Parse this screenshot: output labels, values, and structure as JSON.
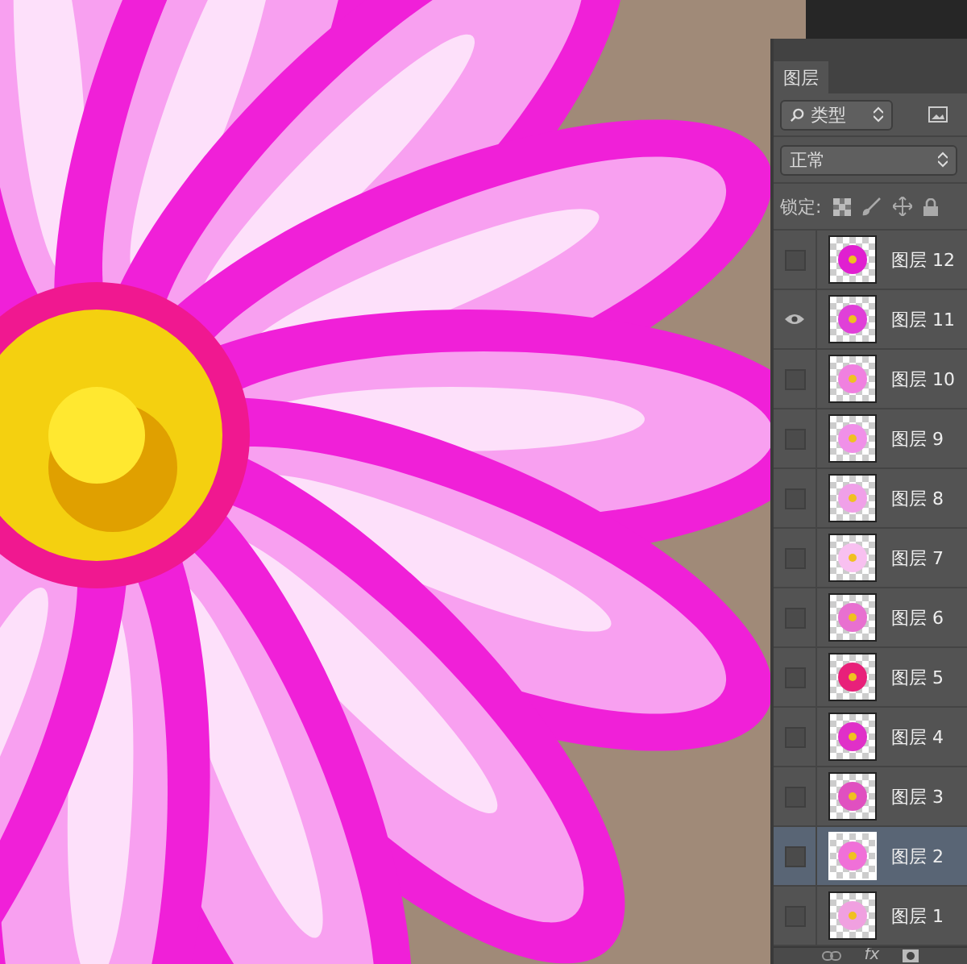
{
  "layers_panel": {
    "tab": {
      "label": "图层",
      "selected": true
    },
    "filter": {
      "value": "类型"
    },
    "blend_mode": {
      "value": "正常"
    },
    "lock": {
      "label": "锁定:"
    },
    "layers": [
      {
        "name": "图层 12",
        "visible": false,
        "selected": false,
        "color": "#e020d0"
      },
      {
        "name": "图层 11",
        "visible": true,
        "selected": false,
        "color": "#e040d8"
      },
      {
        "name": "图层 10",
        "visible": false,
        "selected": false,
        "color": "#f080e0"
      },
      {
        "name": "图层 9",
        "visible": false,
        "selected": false,
        "color": "#f090e8"
      },
      {
        "name": "图层 8",
        "visible": false,
        "selected": false,
        "color": "#f0a0e8"
      },
      {
        "name": "图层 7",
        "visible": false,
        "selected": false,
        "color": "#f8c0f0"
      },
      {
        "name": "图层 6",
        "visible": false,
        "selected": false,
        "color": "#e870d0"
      },
      {
        "name": "图层 5",
        "visible": false,
        "selected": false,
        "color": "#e8207a"
      },
      {
        "name": "图层 4",
        "visible": false,
        "selected": false,
        "color": "#e030c8"
      },
      {
        "name": "图层 3",
        "visible": false,
        "selected": false,
        "color": "#e050c0"
      },
      {
        "name": "图层 2",
        "visible": false,
        "selected": true,
        "color": "#f070d8"
      },
      {
        "name": "图层 1",
        "visible": false,
        "selected": false,
        "color": "#f0a0e0"
      }
    ],
    "footer": {
      "fx_label": "fx"
    }
  }
}
